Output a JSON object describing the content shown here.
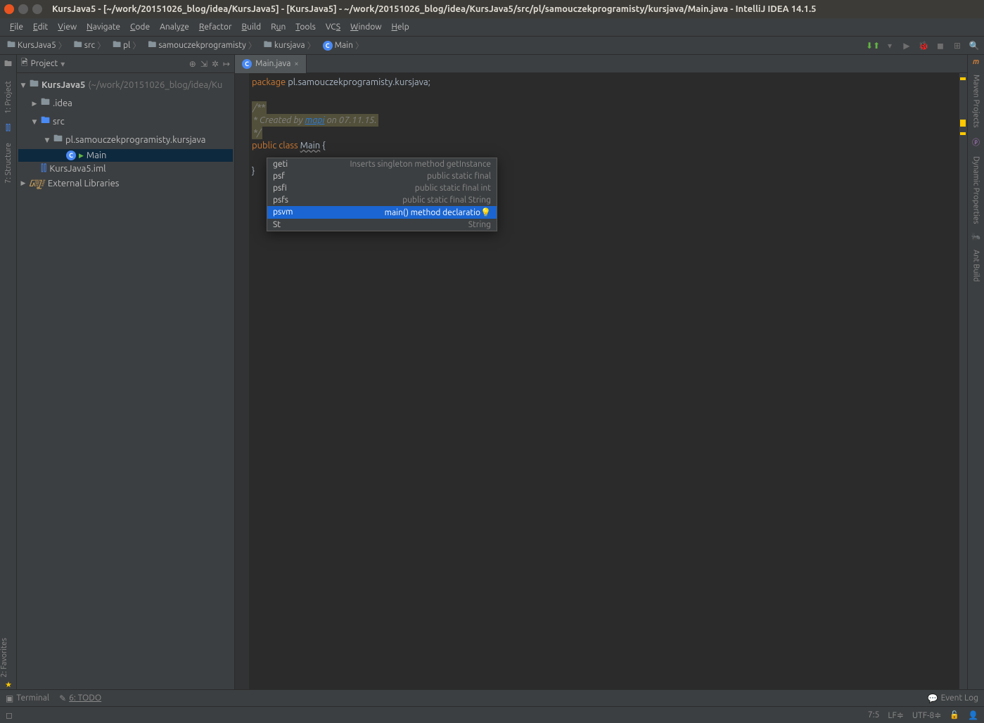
{
  "window": {
    "title": "KursJava5 - [~/work/20151026_blog/idea/KursJava5] - [KursJava5] - ~/work/20151026_blog/idea/KursJava5/src/pl/samouczekprogramisty/kursjava/Main.java - IntelliJ IDEA 14.1.5"
  },
  "menu": {
    "items": [
      "File",
      "Edit",
      "View",
      "Navigate",
      "Code",
      "Analyze",
      "Refactor",
      "Build",
      "Run",
      "Tools",
      "VCS",
      "Window",
      "Help"
    ]
  },
  "breadcrumb": {
    "items": [
      {
        "icon": "folder",
        "label": "KursJava5"
      },
      {
        "icon": "folder",
        "label": "src"
      },
      {
        "icon": "folder",
        "label": "pl"
      },
      {
        "icon": "folder",
        "label": "samouczekprogramisty"
      },
      {
        "icon": "folder",
        "label": "kursjava"
      },
      {
        "icon": "class",
        "label": "Main"
      }
    ]
  },
  "project_panel": {
    "title": "Project",
    "tree": {
      "root": {
        "label": "KursJava5",
        "path": "(~/work/20151026_blog/idea/Ku"
      },
      "idea": ".idea",
      "src": "src",
      "package": "pl.samouczekprogramisty.kursjava",
      "main": "Main",
      "iml": "KursJava5.iml",
      "ext_libs": "External Libraries"
    }
  },
  "left_gutter": {
    "project": "1: Project",
    "structure": "7: Structure"
  },
  "right_gutter": {
    "maven": "Maven Projects",
    "dynamic": "Dynamic Properties",
    "ant": "Ant Build"
  },
  "editor": {
    "tab": "Main.java",
    "code": {
      "package_kw": "package",
      "package_name": "pl.samouczekprogramisty.kursjava",
      "semicolon": ";",
      "comment_open": "/**",
      "comment_line": " * Created by ",
      "comment_author": "mapi",
      "comment_date": " on 07.11.15.",
      "comment_close": " */",
      "public_kw": "public",
      "class_kw": "class",
      "class_name": "Main",
      "brace_open": "{",
      "brace_close": "}"
    }
  },
  "completion": {
    "items": [
      {
        "key": "geti",
        "desc": "Inserts singleton method getInstance"
      },
      {
        "key": "psf",
        "desc": "public static final"
      },
      {
        "key": "psfi",
        "desc": "public static final int"
      },
      {
        "key": "psfs",
        "desc": "public static final String"
      },
      {
        "key": "psvm",
        "desc": "main() method declaratio"
      },
      {
        "key": "St",
        "desc": "String"
      }
    ],
    "selected_index": 4
  },
  "left_sidebar": {
    "favorites": "2: Favorites"
  },
  "bottom_tools": {
    "terminal": "Terminal",
    "todo": "6: TODO",
    "event_log": "Event Log"
  },
  "status": {
    "position": "7:5",
    "line_sep": "LF≑",
    "encoding": "UTF-8≑"
  }
}
